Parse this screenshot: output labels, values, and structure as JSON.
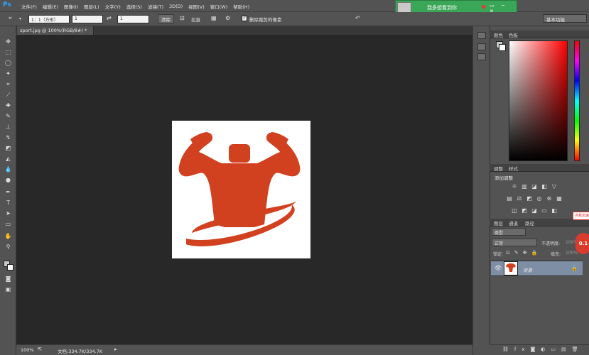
{
  "app": {
    "logo": "Ps"
  },
  "menu": [
    "文件(F)",
    "编辑(E)",
    "图像(I)",
    "图层(L)",
    "文字(Y)",
    "选择(S)",
    "滤镜(T)",
    "3D(D)",
    "视图(V)",
    "窗口(W)",
    "帮助(H)"
  ],
  "notification": {
    "text": "我多想看到你",
    "controls": "▭ ─ ✕"
  },
  "options": {
    "ratio": "1：1（方形）",
    "width": "1",
    "height": "1",
    "clear_label": "清除",
    "straighten_label": "拉直",
    "delete_cropped_label": "删除裁剪的像素",
    "delete_cropped_checked": true,
    "workspace": "基本功能"
  },
  "document": {
    "tab": "sport.jpg @ 100%(RGB/8#) *"
  },
  "status": {
    "zoom": "100%",
    "doc_size": "文档:334.7K/334.7K"
  },
  "panels": {
    "color_tabs": [
      "颜色",
      "色板"
    ],
    "adjust_tabs": [
      "调整",
      "样式"
    ],
    "adjust_add": "添加调整",
    "layers_tabs": [
      "图层",
      "通道",
      "路径"
    ],
    "kind_label": "类型",
    "blend_mode": "正常",
    "opacity_label": "不透明度:",
    "opacity_value": "100%",
    "lock_label": "锁定:",
    "fill_label": "填充:",
    "fill_value": "100%",
    "layer_name": "背景",
    "badge_text": "0.1",
    "badge_top": "点我加速"
  },
  "colors": {
    "logo_red": "#d1401f",
    "accent_blue": "#2fa3ff"
  },
  "icons": [
    "crop-icon",
    "swap-icon",
    "grid-icon",
    "gear-icon",
    "reset-icon",
    "eye-icon",
    "lock-icon"
  ]
}
